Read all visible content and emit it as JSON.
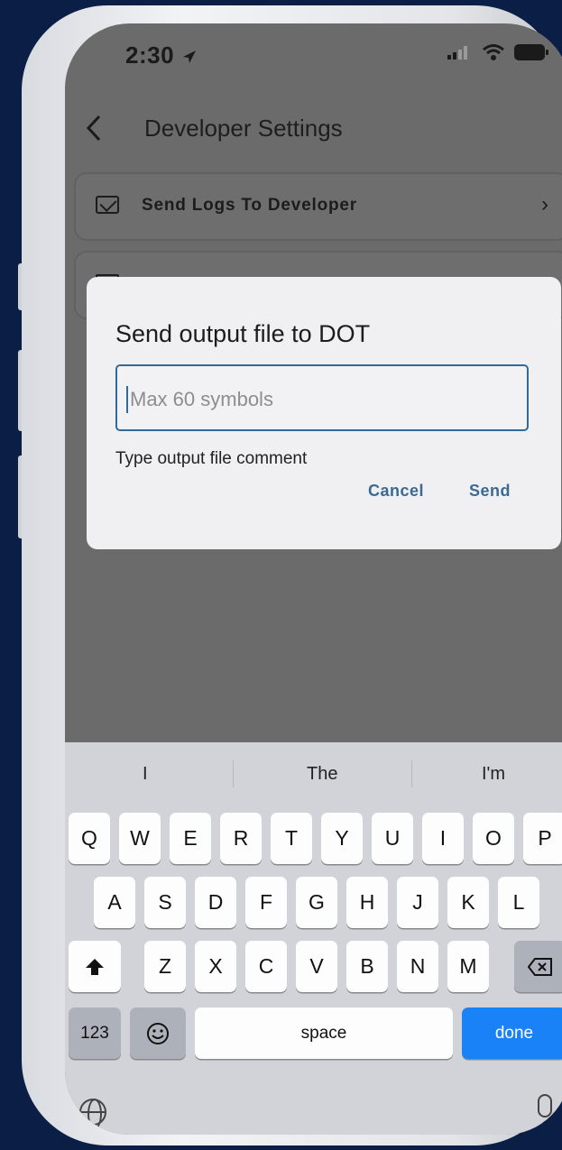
{
  "status": {
    "time": "2:30"
  },
  "header": {
    "title": "Developer Settings"
  },
  "list": [
    {
      "label": "Send Logs To Developer",
      "icon": "mail-icon"
    }
  ],
  "dialog": {
    "title": "Send output file to DOT",
    "input_placeholder": "Max 60 symbols",
    "helper": "Type output file comment",
    "cancel": "Cancel",
    "send": "Send"
  },
  "keyboard": {
    "suggestions": [
      "I",
      "The",
      "I'm"
    ],
    "row1": [
      "Q",
      "W",
      "E",
      "R",
      "T",
      "Y",
      "U",
      "I",
      "O",
      "P"
    ],
    "row2": [
      "A",
      "S",
      "D",
      "F",
      "G",
      "H",
      "J",
      "K",
      "L"
    ],
    "row3": [
      "Z",
      "X",
      "C",
      "V",
      "B",
      "N",
      "M"
    ],
    "numbers": "123",
    "space": "space",
    "done": "done"
  },
  "colors": {
    "accent_blue": "#1982f7",
    "dialog_button": "#3a6a93",
    "background": "#0b1f46"
  }
}
